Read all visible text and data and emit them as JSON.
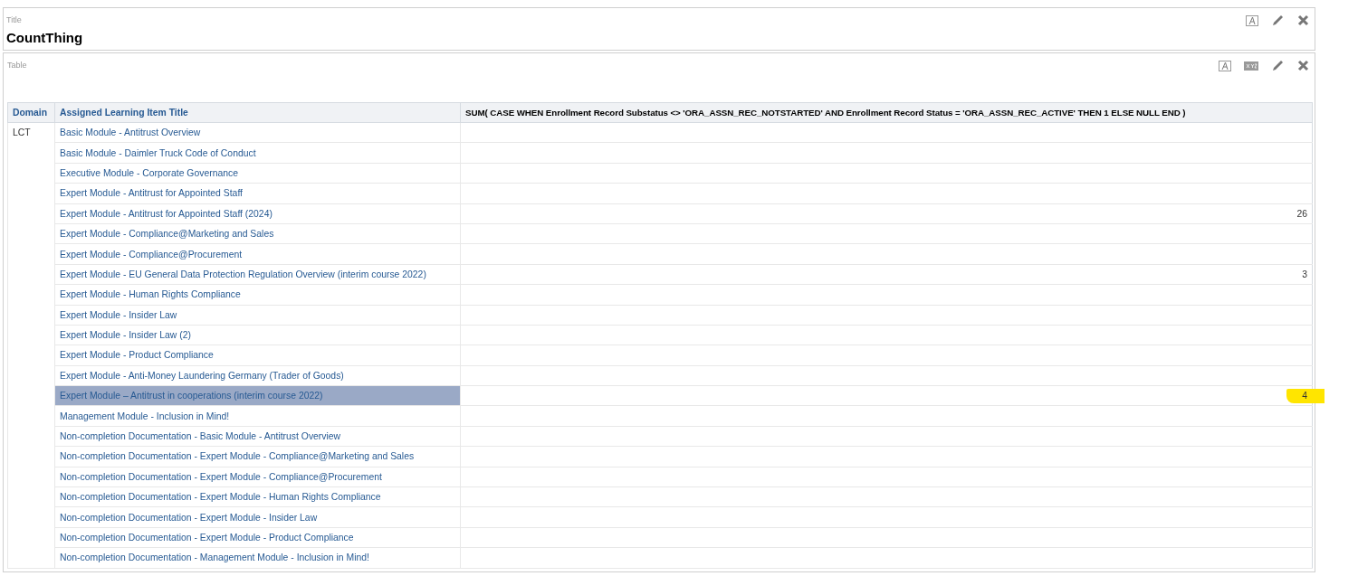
{
  "title_panel": {
    "label": "Title",
    "title": "CountThing"
  },
  "table_panel": {
    "label": "Table",
    "columns": [
      "Domain",
      "Assigned Learning Item Title",
      "SUM( CASE WHEN Enrollment Record Substatus <> 'ORA_ASSN_REC_NOTSTARTED' AND Enrollment Record Status = 'ORA_ASSN_REC_ACTIVE' THEN 1 ELSE NULL END )"
    ],
    "domain": "LCT",
    "rows": [
      {
        "title": "Basic Module - Antitrust Overview",
        "value": "",
        "selected": false,
        "marked": false
      },
      {
        "title": "Basic Module - Daimler Truck Code of Conduct",
        "value": "",
        "selected": false,
        "marked": false
      },
      {
        "title": "Executive Module - Corporate Governance",
        "value": "",
        "selected": false,
        "marked": false
      },
      {
        "title": "Expert Module - Antitrust for Appointed Staff",
        "value": "",
        "selected": false,
        "marked": false
      },
      {
        "title": "Expert Module - Antitrust for Appointed Staff (2024)",
        "value": "26",
        "selected": false,
        "marked": false
      },
      {
        "title": "Expert Module - Compliance@Marketing and Sales",
        "value": "",
        "selected": false,
        "marked": false
      },
      {
        "title": "Expert Module - Compliance@Procurement",
        "value": "",
        "selected": false,
        "marked": false
      },
      {
        "title": "Expert Module - EU General Data Protection Regulation Overview (interim course 2022)",
        "value": "3",
        "selected": false,
        "marked": false
      },
      {
        "title": "Expert Module - Human Rights Compliance",
        "value": "",
        "selected": false,
        "marked": false
      },
      {
        "title": "Expert Module - Insider Law",
        "value": "",
        "selected": false,
        "marked": false
      },
      {
        "title": "Expert Module - Insider Law (2)",
        "value": "",
        "selected": false,
        "marked": false
      },
      {
        "title": "Expert Module - Product Compliance",
        "value": "",
        "selected": false,
        "marked": false
      },
      {
        "title": "Expert Module - Anti-Money Laundering Germany (Trader of Goods)",
        "value": "",
        "selected": false,
        "marked": false
      },
      {
        "title": "Expert Module – Antitrust in cooperations (interim course 2022)",
        "value": "4",
        "selected": true,
        "marked": true
      },
      {
        "title": "Management Module - Inclusion in Mind!",
        "value": "",
        "selected": false,
        "marked": false
      },
      {
        "title": "Non-completion Documentation - Basic Module - Antitrust Overview",
        "value": "",
        "selected": false,
        "marked": false
      },
      {
        "title": "Non-completion Documentation - Expert Module - Compliance@Marketing and Sales",
        "value": "",
        "selected": false,
        "marked": false
      },
      {
        "title": "Non-completion Documentation - Expert Module - Compliance@Procurement",
        "value": "",
        "selected": false,
        "marked": false
      },
      {
        "title": "Non-completion Documentation - Expert Module - Human Rights Compliance",
        "value": "",
        "selected": false,
        "marked": false
      },
      {
        "title": "Non-completion Documentation - Expert Module - Insider Law",
        "value": "",
        "selected": false,
        "marked": false
      },
      {
        "title": "Non-completion Documentation - Expert Module - Product Compliance",
        "value": "",
        "selected": false,
        "marked": false
      },
      {
        "title": "Non-completion Documentation - Management Module - Inclusion in Mind!",
        "value": "",
        "selected": false,
        "marked": false
      }
    ]
  }
}
